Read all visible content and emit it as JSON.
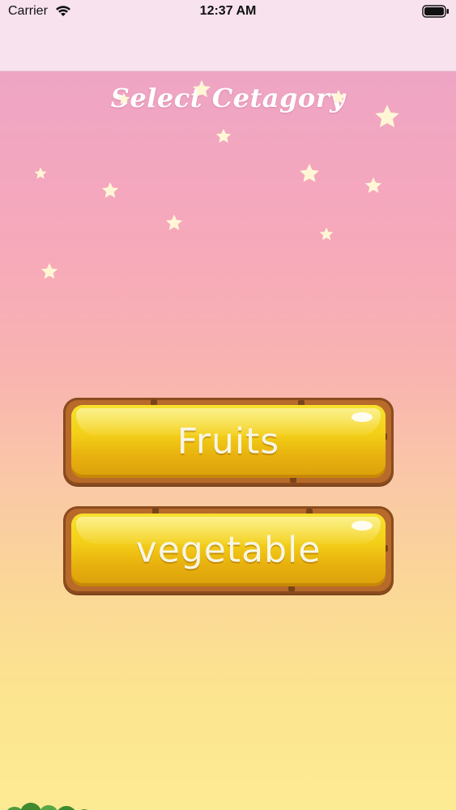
{
  "status_bar": {
    "carrier": "Carrier",
    "time": "12:37 AM",
    "icons": [
      "wifi-icon",
      "battery-icon"
    ]
  },
  "screen": {
    "title": "Select Cetagory",
    "buttons": [
      {
        "label": "Fruits"
      },
      {
        "label": "vegetable"
      }
    ]
  },
  "colors": {
    "nav_bg": "#f7e2ee",
    "sky_top": "#eea5c4",
    "sky_bottom": "#fdeb93",
    "button_gold": "#f3cf18",
    "button_border": "#b86a2b",
    "title_text": "#ffffff"
  }
}
